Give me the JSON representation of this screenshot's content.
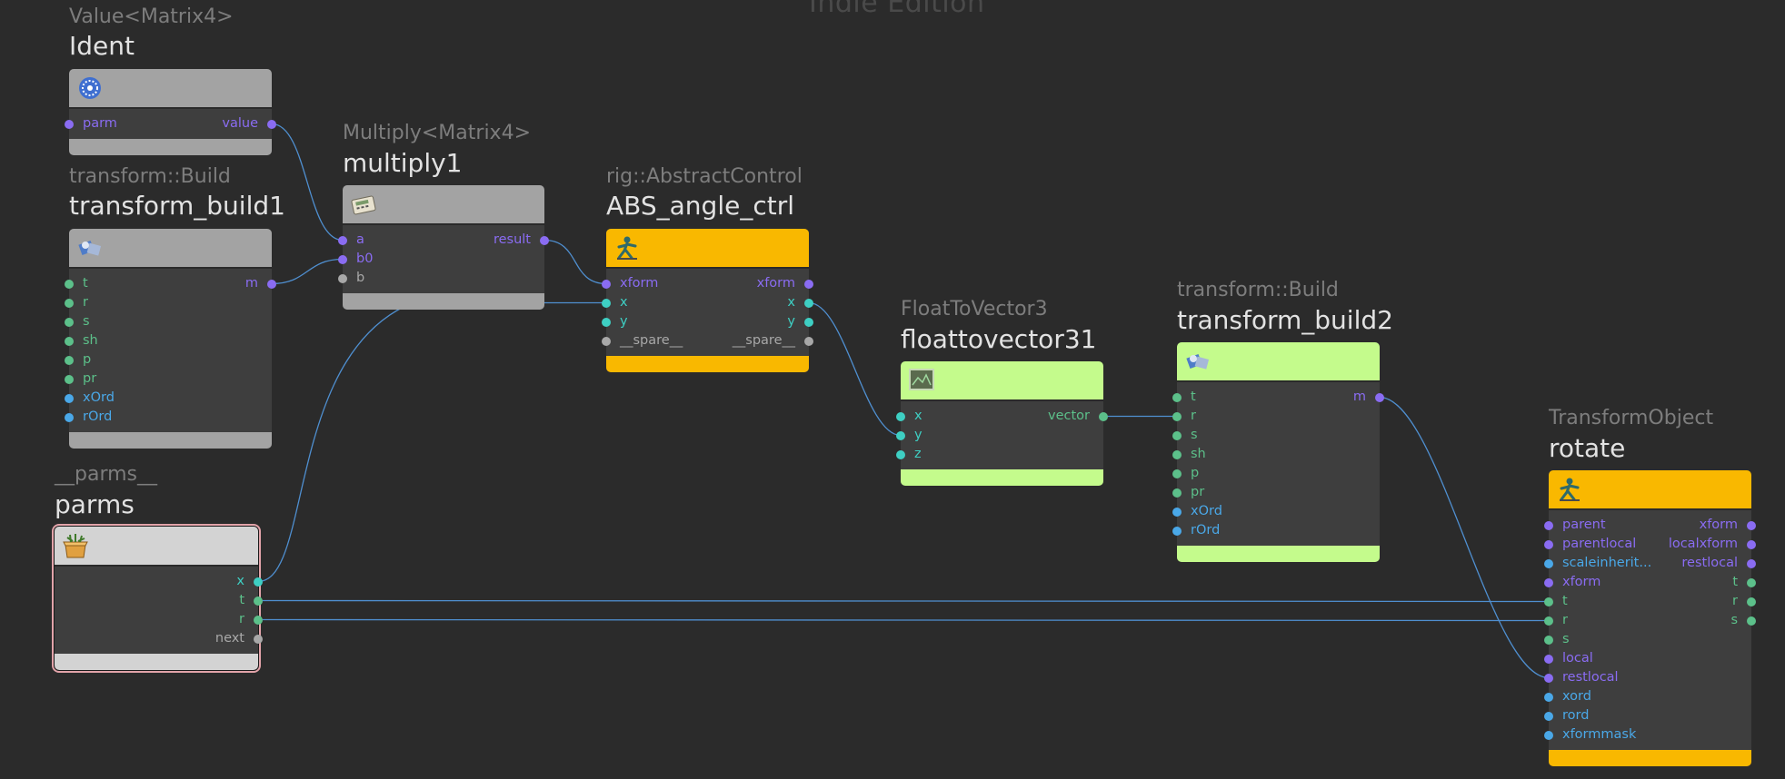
{
  "watermark": "Indie Edition",
  "colors": {
    "background": "#2b2b2b",
    "wire": "#4f8fd0",
    "matrix": "#8a6cf2",
    "float": "#5cc08a",
    "int": "#4aa8e8",
    "vector": "#3ecfc3",
    "undefined": "#a8a8a8",
    "gray_node": "#a3a3a3",
    "orange_node": "#f9b800",
    "green_node": "#c4fb8c",
    "parms_node": "#d3d3d3",
    "parms_outline": "#e2a3a9"
  },
  "nodes": {
    "ident": {
      "type": "Value<Matrix4>",
      "name": "Ident",
      "icon": "gear-icon",
      "color": "#a3a3a3",
      "inputs": [
        {
          "label": "parm",
          "kind": "matrix"
        }
      ],
      "outputs": [
        {
          "label": "value",
          "kind": "matrix"
        }
      ]
    },
    "multiply1": {
      "type": "Multiply<Matrix4>",
      "name": "multiply1",
      "icon": "calculator-icon",
      "color": "#a3a3a3",
      "inputs": [
        {
          "label": "a",
          "kind": "matrix"
        },
        {
          "label": "b0",
          "kind": "matrix"
        },
        {
          "label": "b",
          "kind": "undefined"
        }
      ],
      "outputs": [
        {
          "label": "result",
          "kind": "matrix"
        }
      ]
    },
    "transform_build1": {
      "type": "transform::Build",
      "name": "transform_build1",
      "icon": "transform-build-icon",
      "color": "#a3a3a3",
      "inputs": [
        {
          "label": "t",
          "kind": "float"
        },
        {
          "label": "r",
          "kind": "float"
        },
        {
          "label": "s",
          "kind": "float"
        },
        {
          "label": "sh",
          "kind": "float"
        },
        {
          "label": "p",
          "kind": "float"
        },
        {
          "label": "pr",
          "kind": "float"
        },
        {
          "label": "xOrd",
          "kind": "int"
        },
        {
          "label": "rOrd",
          "kind": "int"
        }
      ],
      "outputs": [
        {
          "label": "m",
          "kind": "matrix"
        }
      ]
    },
    "abs_angle_ctrl": {
      "type": "rig::AbstractControl",
      "name": "ABS_angle_ctrl",
      "icon": "rig-figure-icon",
      "color": "#f9b800",
      "inputs": [
        {
          "label": "xform",
          "kind": "matrix"
        },
        {
          "label": "x",
          "kind": "vector"
        },
        {
          "label": "y",
          "kind": "vector"
        },
        {
          "label": "__spare__",
          "kind": "undefined"
        }
      ],
      "outputs": [
        {
          "label": "xform",
          "kind": "matrix"
        },
        {
          "label": "x",
          "kind": "vector"
        },
        {
          "label": "y",
          "kind": "vector"
        },
        {
          "label": "__spare__",
          "kind": "undefined"
        }
      ]
    },
    "floattovector31": {
      "type": "FloatToVector3",
      "name": "floattovector31",
      "icon": "screen-icon",
      "color": "#c4fb8c",
      "inputs": [
        {
          "label": "x",
          "kind": "vector"
        },
        {
          "label": "y",
          "kind": "vector"
        },
        {
          "label": "z",
          "kind": "vector"
        }
      ],
      "outputs": [
        {
          "label": "vector",
          "kind": "float"
        }
      ]
    },
    "transform_build2": {
      "type": "transform::Build",
      "name": "transform_build2",
      "icon": "transform-build-icon",
      "color": "#c4fb8c",
      "inputs": [
        {
          "label": "t",
          "kind": "float"
        },
        {
          "label": "r",
          "kind": "float"
        },
        {
          "label": "s",
          "kind": "float"
        },
        {
          "label": "sh",
          "kind": "float"
        },
        {
          "label": "p",
          "kind": "float"
        },
        {
          "label": "pr",
          "kind": "float"
        },
        {
          "label": "xOrd",
          "kind": "int"
        },
        {
          "label": "rOrd",
          "kind": "int"
        }
      ],
      "outputs": [
        {
          "label": "m",
          "kind": "matrix"
        }
      ]
    },
    "parms": {
      "type": "__parms__",
      "name": "parms",
      "icon": "parms-box-icon",
      "color": "#d3d3d3",
      "inputs": [],
      "outputs": [
        {
          "label": "x",
          "kind": "vector"
        },
        {
          "label": "t",
          "kind": "float"
        },
        {
          "label": "r",
          "kind": "float"
        },
        {
          "label": "next",
          "kind": "undefined"
        }
      ]
    },
    "rotate": {
      "type": "TransformObject",
      "name": "rotate",
      "icon": "rig-figure-icon",
      "color": "#f9b800",
      "inputs": [
        {
          "label": "parent",
          "kind": "matrix"
        },
        {
          "label": "parentlocal",
          "kind": "matrix"
        },
        {
          "label": "scaleinherit...",
          "kind": "int"
        },
        {
          "label": "xform",
          "kind": "matrix"
        },
        {
          "label": "t",
          "kind": "float"
        },
        {
          "label": "r",
          "kind": "float"
        },
        {
          "label": "s",
          "kind": "float"
        },
        {
          "label": "local",
          "kind": "matrix"
        },
        {
          "label": "restlocal",
          "kind": "matrix"
        },
        {
          "label": "xord",
          "kind": "int"
        },
        {
          "label": "rord",
          "kind": "int"
        },
        {
          "label": "xformmask",
          "kind": "int"
        }
      ],
      "outputs": [
        {
          "label": "xform",
          "kind": "matrix"
        },
        {
          "label": "localxform",
          "kind": "matrix"
        },
        {
          "label": "restlocal",
          "kind": "matrix"
        },
        {
          "label": "t",
          "kind": "float"
        },
        {
          "label": "r",
          "kind": "float"
        },
        {
          "label": "s",
          "kind": "float"
        }
      ]
    }
  }
}
